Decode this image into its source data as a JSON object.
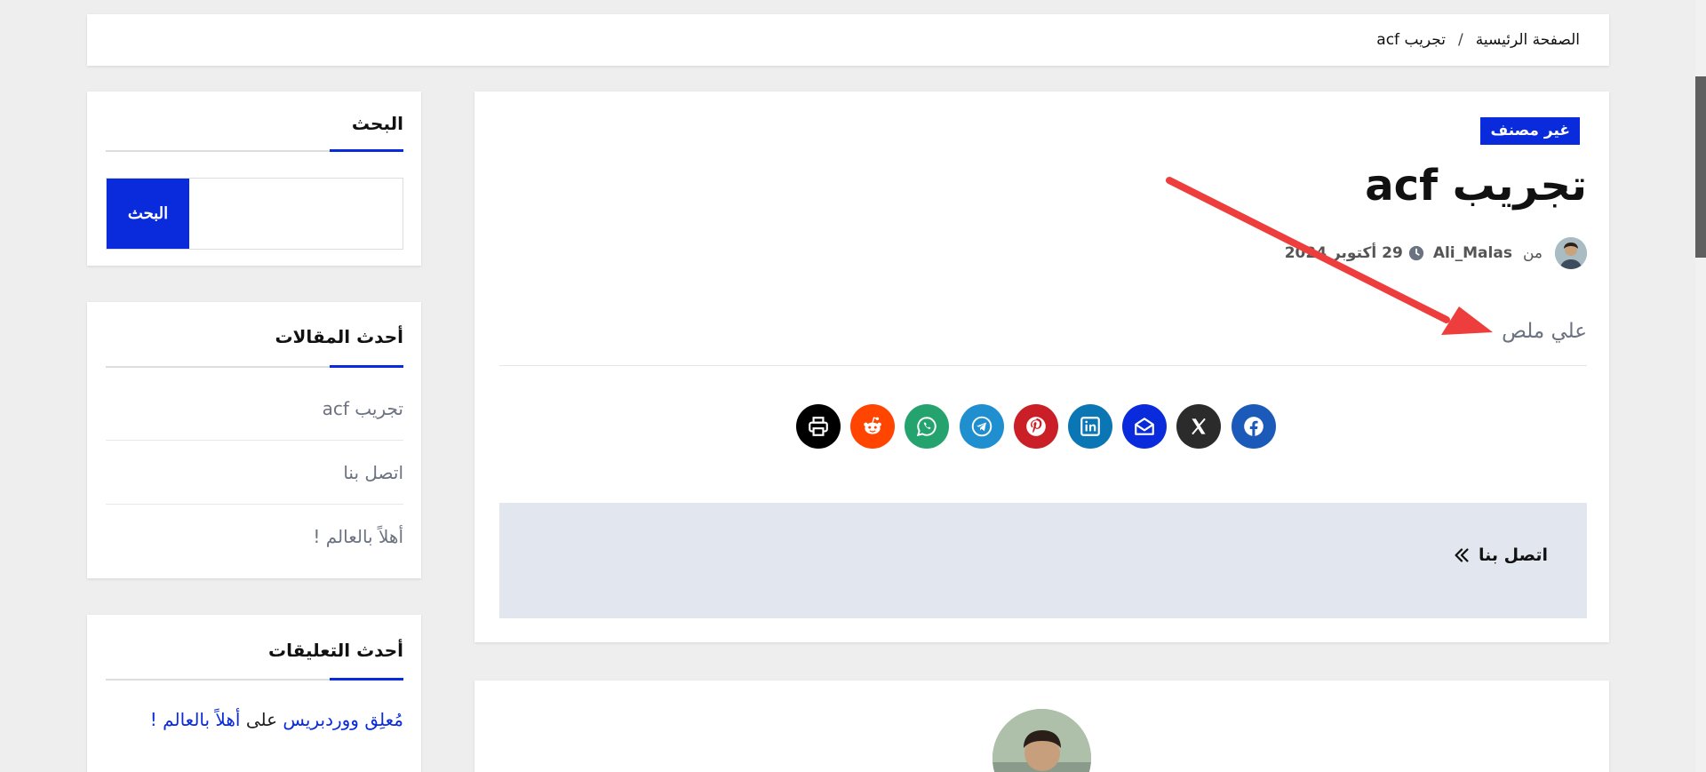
{
  "breadcrumb": {
    "home": "الصفحة الرئيسية",
    "separator": "/",
    "current": "تجريب acf"
  },
  "post": {
    "category": "غير مصنف",
    "title": "تجريب acf",
    "meta": {
      "from_label": "من",
      "author": "Ali_Malas",
      "date": "29 أكتوبر 2024"
    },
    "field_value": "علي ملص"
  },
  "share": {
    "buttons": [
      {
        "icon": "printer-icon",
        "color": "#000000"
      },
      {
        "icon": "reddit-icon",
        "color": "#ff4500"
      },
      {
        "icon": "whatsapp-icon",
        "color": "#25a36f"
      },
      {
        "icon": "telegram-icon",
        "color": "#1f8fcf"
      },
      {
        "icon": "pinterest-icon",
        "color": "#cb1f27"
      },
      {
        "icon": "linkedin-icon",
        "color": "#0b76b4"
      },
      {
        "icon": "email-icon",
        "color": "#0a2bdc"
      },
      {
        "icon": "x-icon",
        "color": "#2b2b2b"
      },
      {
        "icon": "facebook-icon",
        "color": "#1b5ab8"
      }
    ]
  },
  "post_nav": {
    "next_label": "اتصل بنا"
  },
  "sidebar": {
    "search": {
      "title": "البحث",
      "button": "البحث",
      "placeholder": ""
    },
    "recent_posts": {
      "title": "أحدث المقالات",
      "items": [
        "تجريب acf",
        "اتصل بنا",
        "أهلاً بالعالم !"
      ]
    },
    "recent_comments": {
      "title": "أحدث التعليقات",
      "commenter": "مُعلِق ووردبريس",
      "on": "على",
      "post": "أهلاً بالعالم !"
    }
  },
  "colors": {
    "accent": "#0a2bdc",
    "annotation_arrow": "#ee3d3d",
    "page_bg": "#eeeeee"
  }
}
